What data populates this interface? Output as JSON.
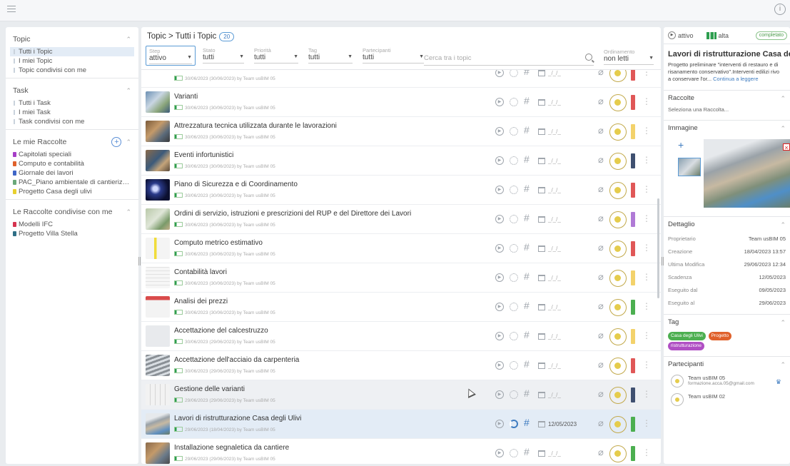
{
  "topbar": {
    "info_glyph": "i"
  },
  "left": {
    "topic": {
      "title": "Topic",
      "items": [
        "Tutti i Topic",
        "I miei Topic",
        "Topic condivisi con me"
      ]
    },
    "task": {
      "title": "Task",
      "items": [
        "Tutti i Task",
        "I miei Task",
        "Task condivisi con me"
      ]
    },
    "mie_raccolte": {
      "title": "Le mie Raccolte",
      "items": [
        {
          "label": "Capitolati speciali",
          "color": "#a63ec7"
        },
        {
          "label": "Computo e contabilità",
          "color": "#e0612b"
        },
        {
          "label": "Giornale dei lavori",
          "color": "#3f66c7"
        },
        {
          "label": "PAC_Piano ambientale di cantierizzazio...",
          "color": "#6aa87a"
        },
        {
          "label": "Progetto Casa degli ulivi",
          "color": "#e8d02e"
        }
      ]
    },
    "condivise": {
      "title": "Le Raccolte condivise con me",
      "items": [
        {
          "label": "Modelli IFC",
          "color": "#d6334f"
        },
        {
          "label": "Progetto Villa Stella",
          "color": "#2f6f86"
        }
      ]
    }
  },
  "center": {
    "breadcrumb": "Topic > Tutti i Topic",
    "count": "20",
    "filters": [
      {
        "label": "Step",
        "value": "attivo"
      },
      {
        "label": "Stato",
        "value": "tutti"
      },
      {
        "label": "Priorità",
        "value": "tutti"
      },
      {
        "label": "Tag",
        "value": "tutti"
      },
      {
        "label": "Partecipanti",
        "value": "tutti"
      }
    ],
    "search_placeholder": "Cerca tra i topic",
    "ordering": {
      "label": "Ordinamento",
      "value": "non letti"
    },
    "date_placeholder": "_/_/_",
    "rows": [
      {
        "title": "",
        "meta": "30/06/2023 (30/06/2023) by Team usBIM 05",
        "status": "#e05757",
        "date": "_/_/_"
      },
      {
        "title": "Varianti",
        "meta": "30/06/2023 (30/06/2023) by Team usBIM 05",
        "status": "#e05757",
        "date": "_/_/_"
      },
      {
        "title": "Attrezzatura tecnica utilizzata durante le lavorazioni",
        "meta": "30/06/2023 (30/06/2023) by Team usBIM 05",
        "status": "#f3d26b",
        "date": "_/_/_"
      },
      {
        "title": "Eventi infortunistici",
        "meta": "30/06/2023 (30/06/2023) by Team usBIM 05",
        "status": "#3f5070",
        "date": "_/_/_"
      },
      {
        "title": "Piano di Sicurezza e di Coordinamento",
        "meta": "30/06/2023 (30/06/2023) by Team usBIM 05",
        "status": "#e05757",
        "date": "_/_/_"
      },
      {
        "title": "Ordini di servizio, istruzioni e prescrizioni del RUP e del Direttore dei Lavori",
        "meta": "30/06/2023 (30/06/2023) by Team usBIM 05",
        "status": "#b07ad6",
        "date": "_/_/_"
      },
      {
        "title": "Computo metrico estimativo",
        "meta": "30/06/2023 (30/06/2023) by Team usBIM 05",
        "status": "#e05757",
        "date": "_/_/_"
      },
      {
        "title": "Contabilità lavori",
        "meta": "30/06/2023 (30/06/2023) by Team usBIM 05",
        "status": "#f3d26b",
        "date": "_/_/_"
      },
      {
        "title": "Analisi dei prezzi",
        "meta": "30/06/2023 (30/06/2023) by Team usBIM 05",
        "status": "#4caf50",
        "date": "_/_/_"
      },
      {
        "title": "Accettazione del calcestruzzo",
        "meta": "30/06/2023 (29/06/2023) by Team usBIM 05",
        "status": "#f3d26b",
        "date": "_/_/_"
      },
      {
        "title": "Accettazione dell'acciaio da carpenteria",
        "meta": "30/06/2023 (29/06/2023) by Team usBIM 05",
        "status": "#e05757",
        "date": "_/_/_"
      },
      {
        "title": "Gestione delle varianti",
        "meta": "29/06/2023 (29/06/2023) by Team usBIM 05",
        "status": "#3f5070",
        "date": "_/_/_"
      },
      {
        "title": "Lavori di ristrutturazione Casa degli Ulivi",
        "meta": "29/06/2023 (18/04/2023) by Team usBIM 05",
        "status": "#4caf50",
        "date": "12/05/2023"
      },
      {
        "title": "Installazione segnaletica da cantiere",
        "meta": "29/06/2023 (29/06/2023) by Team usBIM 05",
        "status": "#4caf50",
        "date": "_/_/_"
      }
    ]
  },
  "right": {
    "step": "attivo",
    "priority": "alta",
    "status_badge": "completato",
    "title": "Lavori di ristrutturazione Casa de...",
    "desc_line1": "Progetto preliminare \"interventi di restauro e di",
    "desc_line2": "risanamento conservativo\".Interventi edilizi rivo",
    "desc_line3": "a conservare l'or...",
    "read_more": "Continua a leggere",
    "raccolte_title": "Raccolte",
    "raccolte_placeholder": "Seleziona una Raccolta...",
    "immagine_title": "Immagine",
    "dettaglio_title": "Dettaglio",
    "details": [
      {
        "k": "Proprietario",
        "v": "Team usBIM 05"
      },
      {
        "k": "Creazione",
        "v": "18/04/2023 13:57"
      },
      {
        "k": "Ultima Modifica",
        "v": "29/06/2023 12:34"
      },
      {
        "k": "Scadenza",
        "v": "12/05/2023"
      },
      {
        "k": "Eseguito dal",
        "v": "09/05/2023"
      },
      {
        "k": "Eseguito al",
        "v": "29/06/2023"
      }
    ],
    "tag_title": "Tag",
    "tags": [
      {
        "label": "Casa degli Ulivi",
        "color": "#4caf50"
      },
      {
        "label": "Progetto",
        "color": "#e0612b"
      },
      {
        "label": "ristrutturazione",
        "color": "#b04fc4"
      }
    ],
    "partecipanti_title": "Partecipanti",
    "participants": [
      {
        "name": "Team usBIM 05",
        "email": "formazione.acca.05@gmail.com"
      },
      {
        "name": "Team usBIM 02",
        "email": ""
      }
    ]
  }
}
